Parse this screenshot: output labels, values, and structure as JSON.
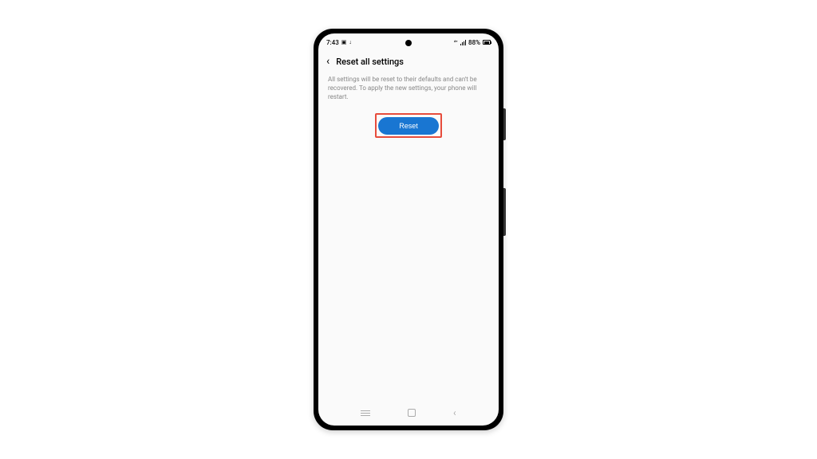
{
  "statusBar": {
    "time": "7:43",
    "cameraIcon": "📹",
    "downloadIcon": "⬇",
    "networkLabel": "⁴⁺",
    "battery": "88%"
  },
  "header": {
    "title": "Reset all settings"
  },
  "body": {
    "description": "All settings will be reset to their defaults and can't be recovered. To apply the new settings, your phone will restart.",
    "resetLabel": "Reset"
  }
}
